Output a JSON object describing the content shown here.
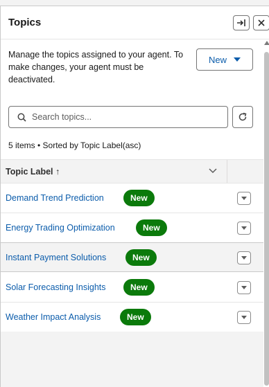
{
  "header": {
    "title": "Topics"
  },
  "description": "Manage the topics assigned to your agent. To make changes, your agent must be deactivated.",
  "new_button": {
    "label": "New"
  },
  "search": {
    "placeholder": "Search topics..."
  },
  "meta": "5 items • Sorted by Topic Label(asc)",
  "table": {
    "column_label": "Topic Label ↑",
    "rows": [
      {
        "label": "Demand Trend Prediction",
        "badge": "New"
      },
      {
        "label": "Energy Trading Optimization",
        "badge": "New"
      },
      {
        "label": "Instant Payment Solutions",
        "badge": "New"
      },
      {
        "label": "Solar Forecasting Insights",
        "badge": "New"
      },
      {
        "label": "Weather Impact Analysis",
        "badge": "New"
      }
    ]
  },
  "icons": {
    "collapse": "collapse-panel-icon",
    "close": "close-icon",
    "search": "search-icon",
    "refresh": "refresh-icon",
    "sort_chevron": "chevron-down-icon",
    "row_menu": "dropdown-icon"
  },
  "colors": {
    "link": "#0b5cab",
    "badge": "#0b7a0b"
  }
}
